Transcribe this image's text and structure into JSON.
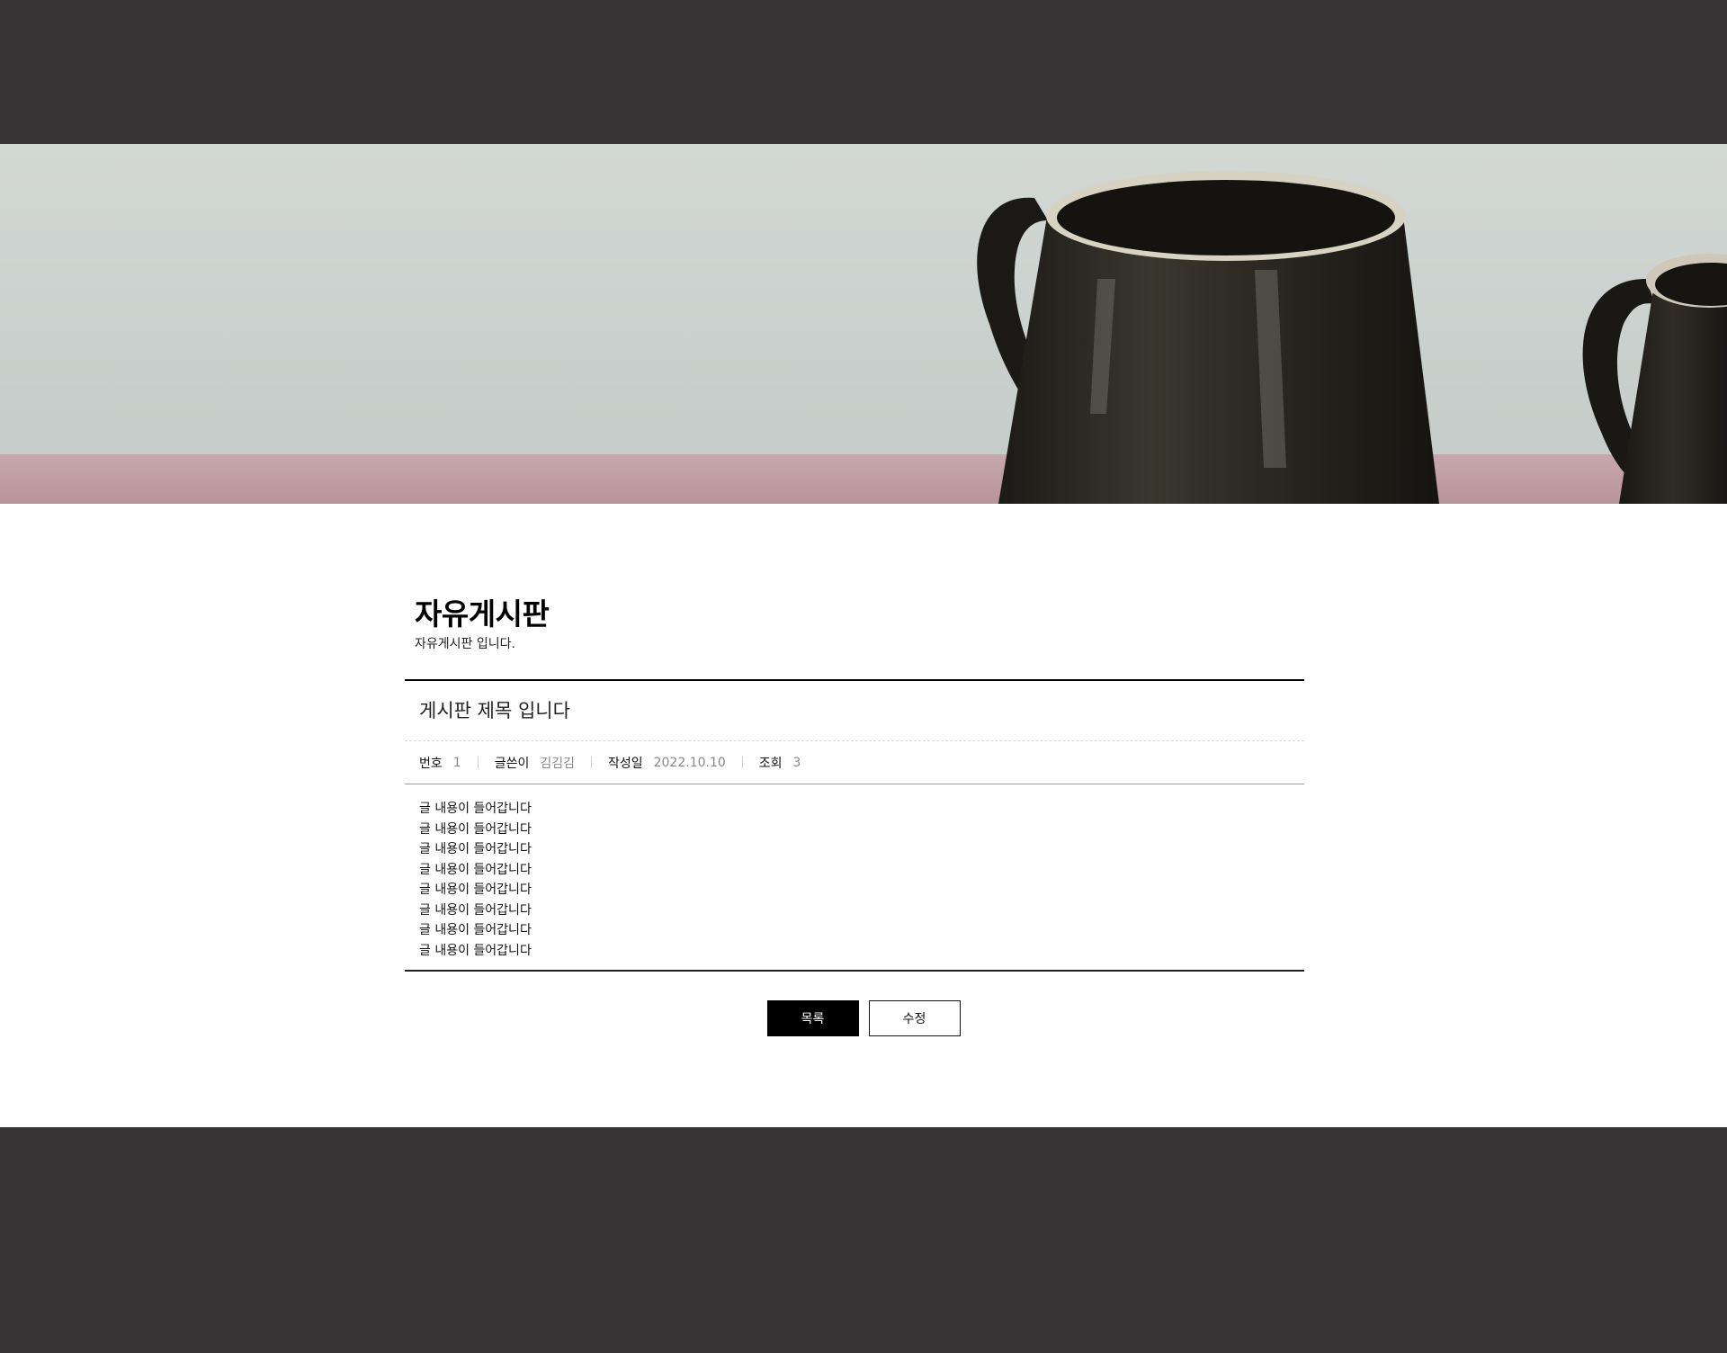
{
  "hero": {
    "image_subject": "dark ceramic mugs on a pink table"
  },
  "board": {
    "title": "자유게시판",
    "subtitle": "자유게시판 입니다."
  },
  "post": {
    "title": "게시판 제목 입니다",
    "info": {
      "number_label": "번호",
      "number_value": "1",
      "author_label": "글쓴이",
      "author_value": "김김김",
      "date_label": "작성일",
      "date_value": "2022.10.10",
      "views_label": "조회",
      "views_value": "3"
    },
    "body_lines": [
      "글 내용이 들어갑니다",
      "글 내용이 들어갑니다",
      "글 내용이 들어갑니다",
      "글 내용이 들어갑니다",
      "글 내용이 들어갑니다",
      "글 내용이 들어갑니다",
      "글 내용이 들어갑니다",
      "글 내용이 들어갑니다"
    ]
  },
  "buttons": {
    "list_label": "목록",
    "edit_label": "수정"
  },
  "colors": {
    "header_bg": "#373536",
    "footer_bg": "#373536",
    "primary_button": "#000000"
  }
}
